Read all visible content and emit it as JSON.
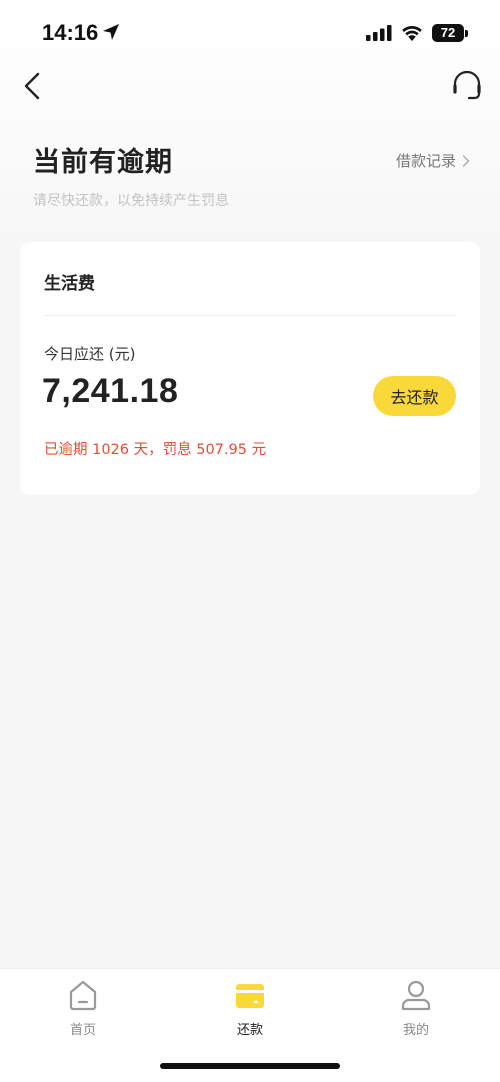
{
  "status_bar": {
    "time": "14:16",
    "battery": "72",
    "icons": [
      "location-arrow-icon",
      "signal-icon",
      "wifi-icon",
      "battery-icon"
    ]
  },
  "nav": {
    "back_icon": "chevron-left-icon",
    "support_icon": "headset-icon"
  },
  "header": {
    "title": "当前有逾期",
    "subtitle": "请尽快还款，以免持续产生罚息",
    "records_link": "借款记录"
  },
  "card": {
    "title": "生活费",
    "due_label": "今日应还 (元)",
    "amount": "7,241.18",
    "repay_button": "去还款",
    "overdue_text": "已逾期 1026 天，罚息 507.95 元"
  },
  "tab_bar": {
    "tabs": [
      {
        "label": "首页",
        "icon": "home-icon",
        "active": false
      },
      {
        "label": "还款",
        "icon": "card-icon",
        "active": true
      },
      {
        "label": "我的",
        "icon": "user-icon",
        "active": false
      }
    ]
  },
  "colors": {
    "accent_yellow": "#f9d93a",
    "overdue_red": "#e0503a",
    "background": "#f6f6f6"
  }
}
